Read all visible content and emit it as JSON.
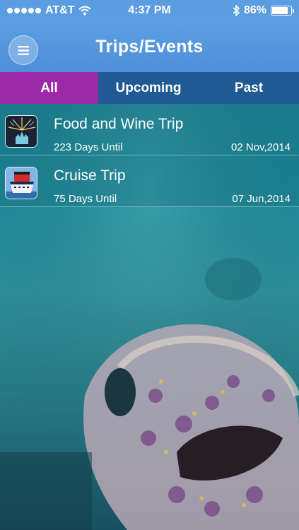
{
  "status_bar": {
    "carrier": "AT&T",
    "time": "4:37 PM",
    "battery": "86%",
    "battery_level": 0.86
  },
  "nav": {
    "title": "Trips/Events",
    "menu_icon": "hamburger-menu-icon"
  },
  "tabs": [
    {
      "label": "All",
      "selected": true
    },
    {
      "label": "Upcoming",
      "selected": false
    },
    {
      "label": "Past",
      "selected": false
    }
  ],
  "trips": [
    {
      "title": "Food and Wine Trip",
      "days": "223 Days Until",
      "date": "02 Nov,2014",
      "thumb_icon": "fireworks-castle-thumbnail"
    },
    {
      "title": "Cruise Trip",
      "days": "75 Days Until",
      "date": "07 Jun,2014",
      "thumb_icon": "cruise-ship-thumbnail"
    }
  ],
  "colors": {
    "nav_blue": "#4f8fd9",
    "tab_selected": "#9c2aa6",
    "tab_unselected": "#1f5a95",
    "background_teal": "#1f8a98"
  }
}
